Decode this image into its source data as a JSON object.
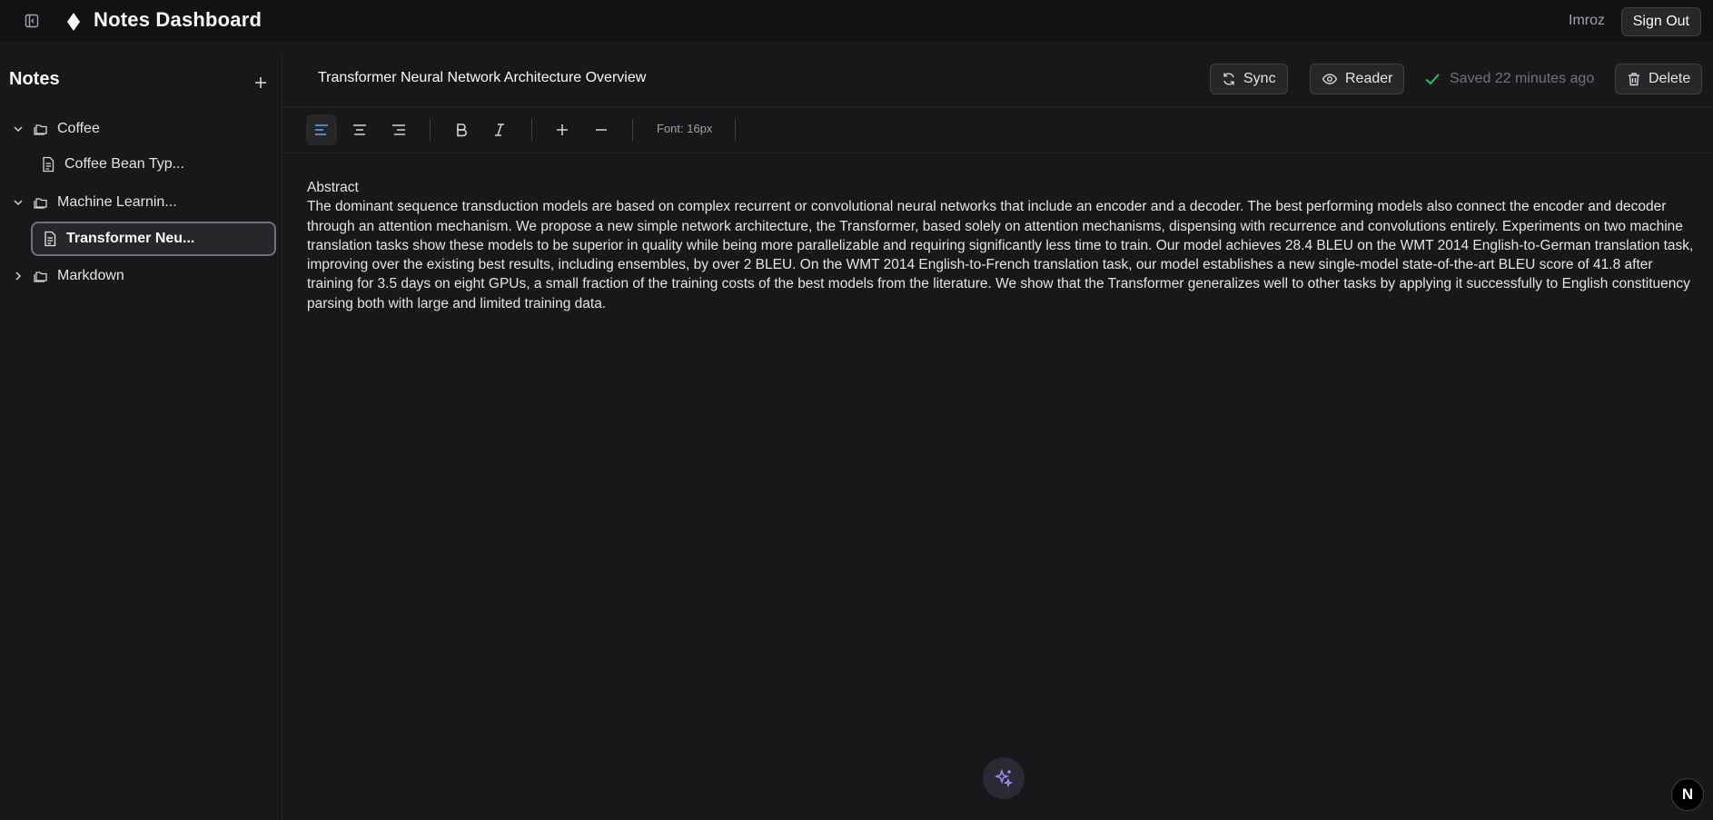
{
  "header": {
    "app_title": "Notes Dashboard",
    "user_name": "Imroz",
    "sign_out_label": "Sign Out",
    "icons": {
      "toggle": "sidebar-toggle-icon",
      "logo": "diamond-logo-icon"
    }
  },
  "sidebar": {
    "title": "Notes",
    "add_icon": "plus-icon",
    "tree": [
      {
        "type": "folder",
        "label": "Coffee",
        "expanded": true
      },
      {
        "type": "note",
        "label": "Coffee Bean Typ..."
      },
      {
        "type": "folder",
        "label": "Machine Learnin...",
        "expanded": true
      },
      {
        "type": "note",
        "label": "Transformer Neu...",
        "selected": true
      },
      {
        "type": "folder",
        "label": "Markdown",
        "expanded": false
      }
    ]
  },
  "editor": {
    "title": "Transformer Neural Network Architecture Overview",
    "sync_label": "Sync",
    "reader_label": "Reader",
    "saved_status": "Saved 22 minutes ago",
    "delete_label": "Delete",
    "font_size_label": "Font: 16px",
    "content_heading": "Abstract",
    "content_body": "The dominant sequence transduction models are based on complex recurrent or convolutional neural networks that include an encoder and a decoder. The best performing models also connect the encoder and decoder through an attention mechanism. We propose a new simple network architecture, the Transformer, based solely on attention mechanisms, dispensing with recurrence and convolutions entirely. Experiments on two machine translation tasks show these models to be superior in quality while being more parallelizable and requiring significantly less time to train. Our model achieves 28.4 BLEU on the WMT 2014 English-to-German translation task, improving over the existing best results, including ensembles, by over 2 BLEU. On the WMT 2014 English-to-French translation task, our model establishes a new single-model state-of-the-art BLEU score of 41.8 after training for 3.5 days on eight GPUs, a small fraction of the training costs of the best models from the literature. We show that the Transformer generalizes well to other tasks by applying it successfully to English constituency parsing both with large and limited training data."
  },
  "floating": {
    "n_badge": "N"
  },
  "colors": {
    "background": "#18181b",
    "topbar": "#121214",
    "accent_blue": "#60a5fa",
    "saved_check": "#22c55e",
    "ai_purple": "#a78bfa"
  }
}
